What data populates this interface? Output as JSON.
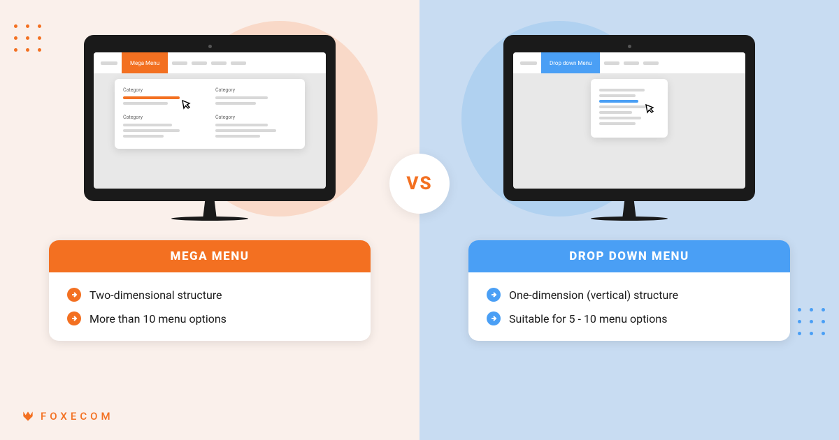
{
  "vs_label": "VS",
  "brand": "FOXECOM",
  "left": {
    "nav_tab": "Mega Menu",
    "category_label": "Category",
    "card_title": "MEGA MENU",
    "bullets": [
      "Two-dimensional structure",
      "More than 10 menu options"
    ]
  },
  "right": {
    "nav_tab": "Drop down Menu",
    "card_title": "DROP DOWN MENU",
    "bullets": [
      "One-dimension (vertical) structure",
      "Suitable for 5 - 10 menu options"
    ]
  },
  "colors": {
    "orange": "#f37021",
    "blue": "#4a9ff5"
  }
}
